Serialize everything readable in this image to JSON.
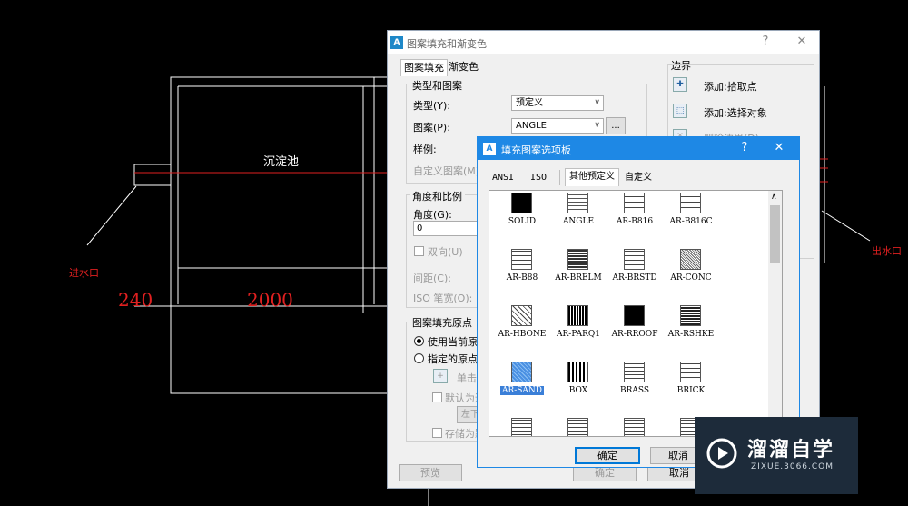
{
  "cad": {
    "tank_label": "沉淀池",
    "inlet_label": "进水口",
    "outlet_label": "出水口",
    "dim_left": "240",
    "dim_mid": "2000"
  },
  "hatch_dialog": {
    "title": "图案填充和渐变色",
    "help": "?",
    "close": "✕",
    "tabs": [
      "图案填充",
      "渐变色"
    ],
    "type_group": {
      "label": "类型和图案",
      "type_label": "类型(Y):",
      "type_value": "预定义",
      "pattern_label": "图案(P):",
      "pattern_value": "ANGLE",
      "browse": "...",
      "sample_label": "样例:",
      "custom_label": "自定义图案(M)"
    },
    "angle_group": {
      "label": "角度和比例",
      "angle_label": "角度(G):",
      "angle_value": "0",
      "double_label": "双向(U)",
      "spacing_label": "间距(C):",
      "iso_label": "ISO 笔宽(O):"
    },
    "origin_group": {
      "label": "图案填充原点",
      "use_current": "使用当前原",
      "specify": "指定的原点",
      "click_set": "单击",
      "default_ext": "默认为边",
      "bottom_left": "左下",
      "store_default": "存储为默"
    },
    "boundary": {
      "label": "边界",
      "add_pick": "添加:拾取点",
      "add_select": "添加:选择对象",
      "remove": "删除边界(D)"
    },
    "preview": "预览",
    "ok": "确定",
    "cancel": "取消"
  },
  "palette": {
    "title": "填充图案选项板",
    "help": "?",
    "close": "✕",
    "tabs": [
      "ANSI",
      "ISO",
      "其他预定义",
      "自定义"
    ],
    "active_tab": "其他预定义",
    "patterns": [
      {
        "name": "SOLID"
      },
      {
        "name": "ANGLE"
      },
      {
        "name": "AR-B816"
      },
      {
        "name": "AR-B816C"
      },
      {
        "name": "AR-B88"
      },
      {
        "name": "AR-BRELM"
      },
      {
        "name": "AR-BRSTD"
      },
      {
        "name": "AR-CONC"
      },
      {
        "name": "AR-HBONE"
      },
      {
        "name": "AR-PARQ1"
      },
      {
        "name": "AR-RROOF"
      },
      {
        "name": "AR-RSHKE"
      },
      {
        "name": "AR-SAND"
      },
      {
        "name": "BOX"
      },
      {
        "name": "BRASS"
      },
      {
        "name": "BRICK"
      }
    ],
    "selected": "AR-SAND",
    "ok": "确定",
    "cancel": "取消"
  },
  "watermark": {
    "brand": "溜溜自学",
    "url": "ZIXUE.3066.COM"
  }
}
